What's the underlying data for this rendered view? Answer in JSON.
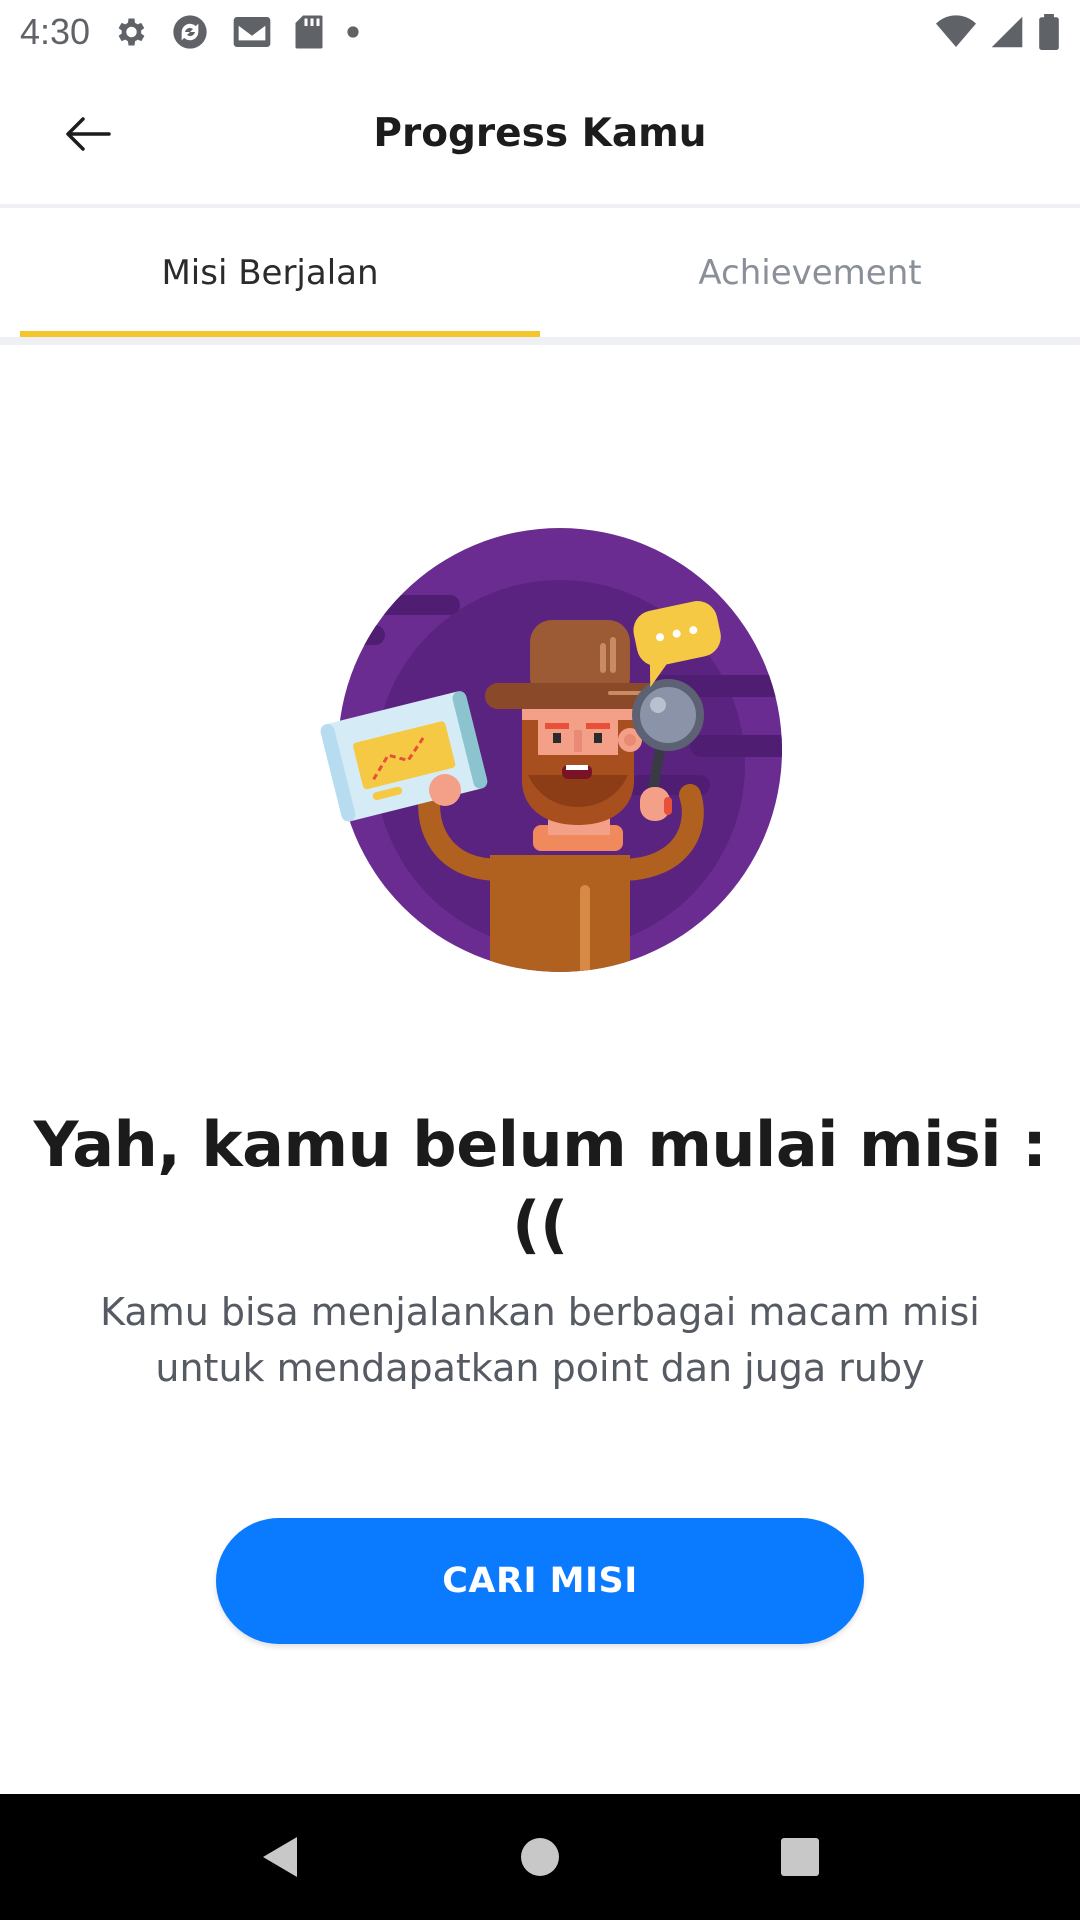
{
  "status_bar": {
    "time": "4:30",
    "icons_left": [
      "settings-icon",
      "sync-icon",
      "gmail-icon",
      "sd-card-icon",
      "dot-icon"
    ],
    "icons_right": [
      "wifi-icon",
      "signal-icon",
      "battery-icon"
    ]
  },
  "app_bar": {
    "title": "Progress Kamu",
    "back_icon": "arrow-left-icon"
  },
  "tabs": [
    {
      "label": "Misi Berjalan",
      "active": true
    },
    {
      "label": "Achievement",
      "active": false
    }
  ],
  "empty_state": {
    "title": "Yah, kamu belum mulai misi : ((",
    "description": "Kamu bisa menjalankan berbagai macam misi untuk mendapatkan point dan juga ruby",
    "illustration": "explorer-illustration"
  },
  "cta": {
    "label": "CARI MISI"
  },
  "colors": {
    "accent": "#f5c62b",
    "primary_button": "#0a7bff",
    "illustration_bg": "#6a2c91"
  },
  "nav_bar": {
    "icons": [
      "back-triangle-icon",
      "home-circle-icon",
      "recents-square-icon"
    ]
  }
}
